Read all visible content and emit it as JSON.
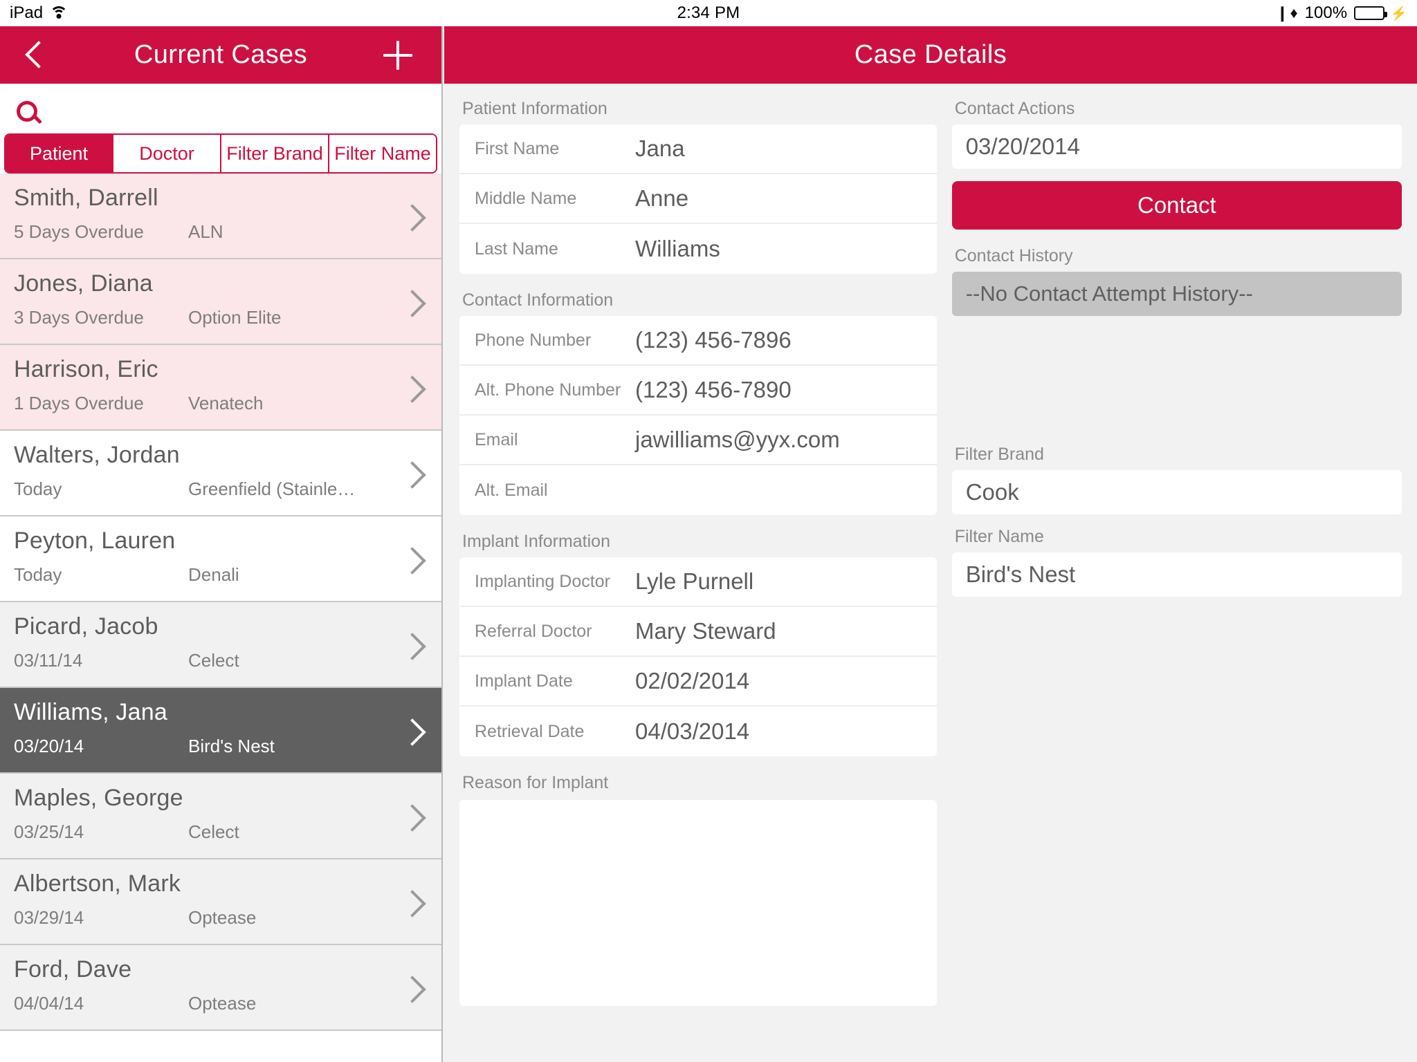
{
  "status_bar": {
    "device": "iPad",
    "wifi_icon": "wifi-icon",
    "time": "2:34 PM",
    "bluetooth_icon": "bluetooth-icon",
    "battery_percent": "100%",
    "battery_icon": "battery-full-icon",
    "charging_icon": "lightning-bolt-icon"
  },
  "master": {
    "nav": {
      "back_icon": "chevron-left-icon",
      "title": "Current Cases",
      "add_icon": "plus-icon"
    },
    "search": {
      "icon": "search-icon",
      "value": "",
      "placeholder": ""
    },
    "segments": [
      {
        "label": "Patient",
        "active": true
      },
      {
        "label": "Doctor",
        "active": false
      },
      {
        "label": "Filter Brand",
        "active": false
      },
      {
        "label": "Filter Name",
        "active": false
      }
    ],
    "cases": [
      {
        "name": "Smith, Darrell",
        "status": "5 Days Overdue",
        "brand": "ALN",
        "style": "overdue"
      },
      {
        "name": "Jones, Diana",
        "status": "3 Days Overdue",
        "brand": "Option Elite",
        "style": "overdue"
      },
      {
        "name": "Harrison, Eric",
        "status": "1 Days Overdue",
        "brand": "Venatech",
        "style": "overdue"
      },
      {
        "name": "Walters, Jordan",
        "status": "Today",
        "brand": "Greenfield (Stainless S…",
        "style": "plain"
      },
      {
        "name": "Peyton, Lauren",
        "status": "Today",
        "brand": "Denali",
        "style": "plain"
      },
      {
        "name": "Picard, Jacob",
        "status": "03/11/14",
        "brand": "Celect",
        "style": "grey"
      },
      {
        "name": "Williams, Jana",
        "status": "03/20/14",
        "brand": "Bird's Nest",
        "style": "selected"
      },
      {
        "name": "Maples, George",
        "status": "03/25/14",
        "brand": "Celect",
        "style": "grey"
      },
      {
        "name": "Albertson, Mark",
        "status": "03/29/14",
        "brand": "Optease",
        "style": "grey"
      },
      {
        "name": "Ford, Dave",
        "status": "04/04/14",
        "brand": "Optease",
        "style": "grey"
      }
    ],
    "row_chevron_icon": "chevron-right-icon"
  },
  "detail": {
    "nav": {
      "title": "Case Details"
    },
    "patient_information": {
      "section_label": "Patient Information",
      "rows": [
        {
          "key": "First Name",
          "value": "Jana"
        },
        {
          "key": "Middle Name",
          "value": "Anne"
        },
        {
          "key": "Last Name",
          "value": "Williams"
        }
      ]
    },
    "contact_information": {
      "section_label": "Contact Information",
      "rows": [
        {
          "key": "Phone Number",
          "value": "(123) 456-7896"
        },
        {
          "key": "Alt. Phone Number",
          "value": "(123) 456-7890"
        },
        {
          "key": "Email",
          "value": "jawilliams@yyx.com"
        },
        {
          "key": "Alt. Email",
          "value": ""
        }
      ]
    },
    "implant_information": {
      "section_label": "Implant Information",
      "rows": [
        {
          "key": "Implanting Doctor",
          "value": "Lyle Purnell"
        },
        {
          "key": "Referral Doctor",
          "value": "Mary Steward"
        },
        {
          "key": "Implant Date",
          "value": "02/02/2014"
        },
        {
          "key": "Retrieval Date",
          "value": "04/03/2014"
        }
      ]
    },
    "reason_for_implant": {
      "section_label": "Reason for Implant",
      "value": ""
    },
    "contact_actions": {
      "section_label": "Contact Actions",
      "date_value": "03/20/2014",
      "contact_button_label": "Contact"
    },
    "contact_history": {
      "section_label": "Contact History",
      "empty_text": "--No Contact Attempt History--"
    },
    "filter_brand": {
      "section_label": "Filter Brand",
      "value": "Cook"
    },
    "filter_name": {
      "section_label": "Filter Name",
      "value": "Bird's Nest"
    }
  },
  "colors": {
    "accent": "#cd1041",
    "overdue_row": "#fbe6e9",
    "selected_row": "#606060",
    "page_background": "#f2f2f2"
  }
}
